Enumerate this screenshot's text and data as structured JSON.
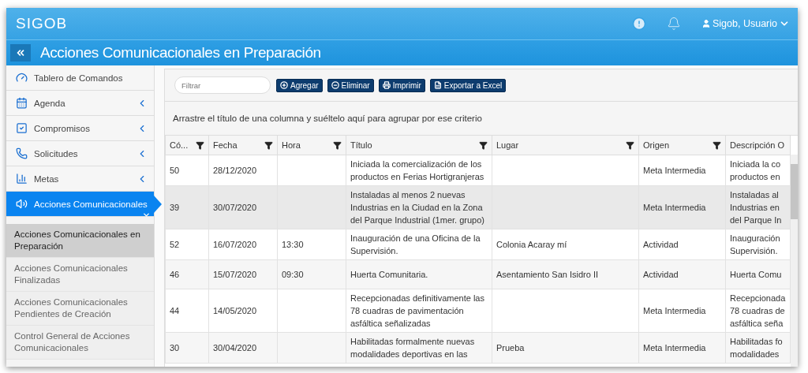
{
  "brand": "SIGOB",
  "user": {
    "name": "Sigob, Usuario"
  },
  "page_title": "Acciones Comunicacionales en Preparación",
  "sidebar": {
    "items": [
      {
        "label": "Tablero de Comandos"
      },
      {
        "label": "Agenda",
        "expanded": false
      },
      {
        "label": "Compromisos",
        "expanded": false
      },
      {
        "label": "Solicitudes",
        "expanded": false
      },
      {
        "label": "Metas",
        "expanded": false
      },
      {
        "label": "Acciones Comunicacionales",
        "expanded": true,
        "selected": true,
        "children": [
          {
            "label": "Acciones Comunicacionales en Preparación",
            "selected": true
          },
          {
            "label": "Acciones Comunicacionales Finalizadas",
            "selected": false
          },
          {
            "label": "Acciones Comunicacionales Pendientes de Creación",
            "selected": false
          },
          {
            "label": "Control General de Acciones Comunicacionales",
            "selected": false
          }
        ]
      }
    ]
  },
  "toolbar": {
    "filter": {
      "placeholder": "Filtrar"
    },
    "buttons": [
      "Agregar",
      "Eliminar",
      "Imprimir",
      "Exportar a Excel"
    ]
  },
  "group_hint": "Arrastre el título de una columna y suéltelo aquí para agrupar por ese criterio",
  "table": {
    "columns": [
      "Có...",
      "Fecha",
      "Hora",
      "Título",
      "Lugar",
      "Origen",
      "Descripción O"
    ],
    "rows": [
      {
        "selected": false,
        "cells": [
          "50",
          "28/12/2020",
          "",
          "Iniciada la comercialización de los productos en Ferias Hortigranjeras",
          "",
          "Meta Intermedia",
          "Iniciada la co\nproductos en"
        ]
      },
      {
        "selected": true,
        "cells": [
          "39",
          "30/07/2020",
          "",
          "Instaladas al menos 2 nuevas Industrias en la Ciudad en la Zona del Parque Industrial (1mer. grupo)",
          "",
          "Meta Intermedia",
          "Instaladas al\nIndustrias en\ndel Parque In"
        ]
      },
      {
        "selected": false,
        "cells": [
          "52",
          "16/07/2020",
          "13:30",
          "Inauguración de una Oficina de la Supervisión.",
          "Colonia Acaray mí",
          "Actividad",
          "Inauguración\nSupervisión."
        ]
      },
      {
        "selected": false,
        "cells": [
          "46",
          "15/07/2020",
          "09:30",
          "Huerta Comunitaria.",
          "Asentamiento San Isidro II",
          "Actividad",
          "Huerta Comu"
        ]
      },
      {
        "selected": false,
        "cells": [
          "44",
          "14/05/2020",
          "",
          "Recepcionadas definitivamente las 78 cuadras de pavimentación asfáltica señalizadas",
          "",
          "Meta Intermedia",
          "Recepcionada\n78 cuadras de\nasfáltica seña"
        ]
      },
      {
        "selected": false,
        "cells": [
          "30",
          "30/04/2020",
          "",
          "Habilitadas formalmente nuevas modalidades deportivas en las",
          "Prueba",
          "Meta Intermedia",
          "Habilitadas fo\nmodalidades"
        ]
      }
    ]
  }
}
